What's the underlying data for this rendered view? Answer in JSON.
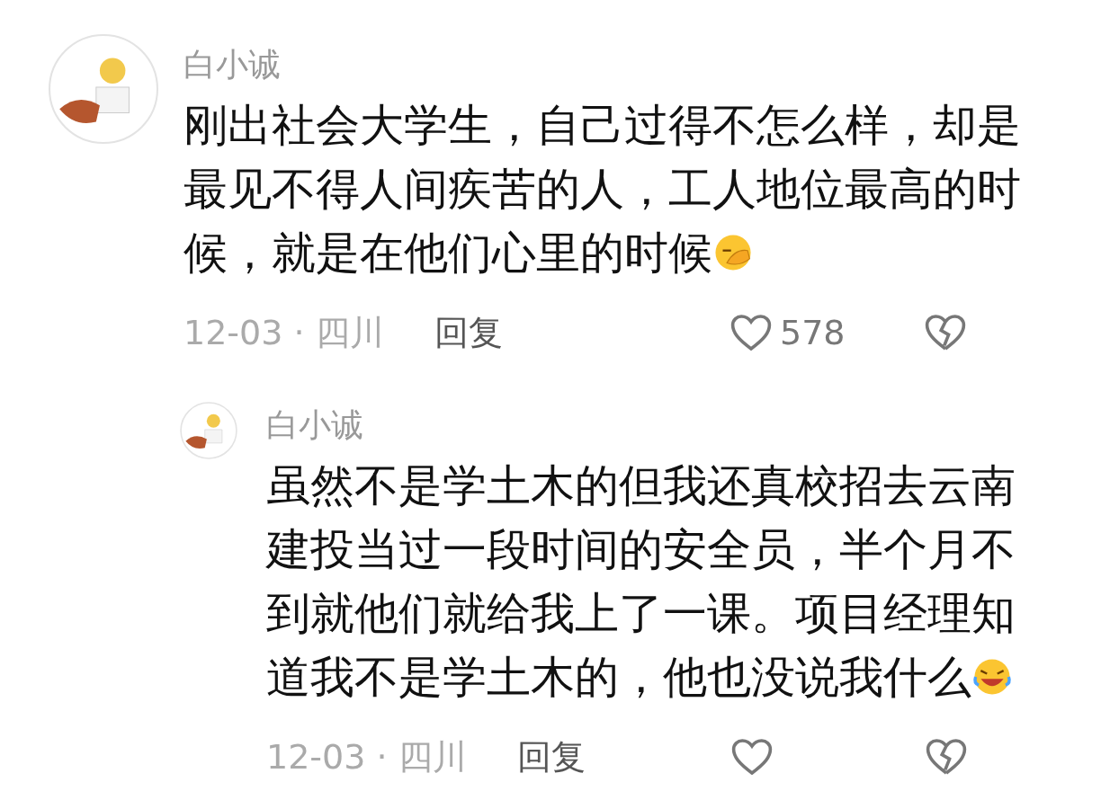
{
  "comment": {
    "author": "白小诚",
    "text_lines": [
      "刚出社会大学生，自己过得不怎么样，却是",
      "最见不得人间疾苦的人，工人地位最高的时",
      "候，就是在他们心里的时候"
    ],
    "meta": "12-03 · 四川",
    "reply": "回复",
    "likes": "578",
    "replies": [
      {
        "author": "白小诚",
        "text_lines": [
          "虽然不是学土木的但我还真校招去云南",
          "建投当过一段时间的安全员，半个月不",
          "到就他们就给我上了一课。项目经理知",
          "道我不是学土木的，他也没说我什么"
        ],
        "meta": "12-03 · 四川",
        "reply": "回复"
      }
    ]
  }
}
